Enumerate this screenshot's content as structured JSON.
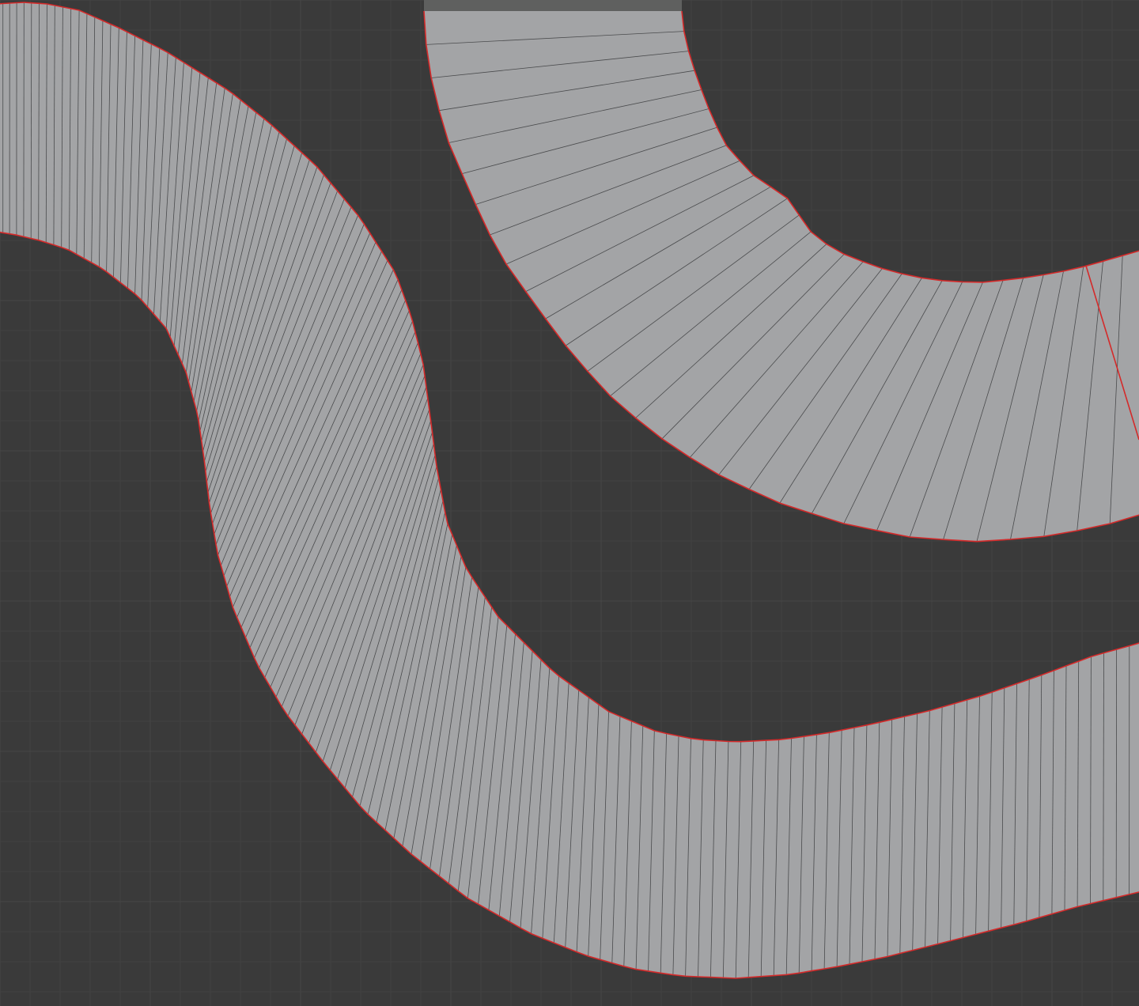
{
  "viewport": {
    "colors": {
      "background": "#3a3a3a",
      "grid_minor": "#414141",
      "grid_major": "#474747",
      "face_fill": "#a3a4a6",
      "face_dark_fill": "#5f605f",
      "edge_wire": "#4a4b4d",
      "seam_edge": "#d42a2a"
    },
    "meshes": [
      {
        "id": "dense-curved-strip",
        "segments": 140
      },
      {
        "id": "arc-strip-upper-right",
        "segments": 30
      }
    ]
  }
}
